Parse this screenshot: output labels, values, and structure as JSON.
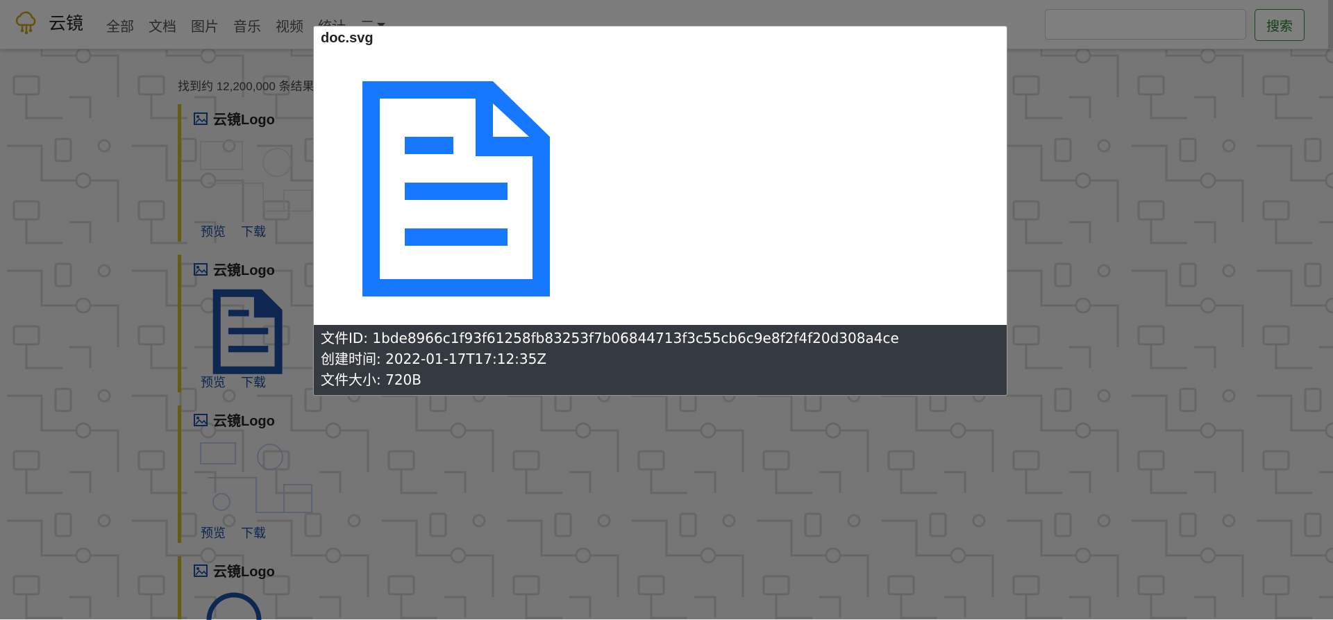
{
  "brand": {
    "name": "云镜"
  },
  "nav": {
    "links": [
      "全部",
      "文档",
      "图片",
      "音乐",
      "视频",
      "统计"
    ],
    "more_label": "三"
  },
  "search": {
    "placeholder": "",
    "button_label": "搜索"
  },
  "results": {
    "count_text": "找到约 12,200,000 条结果",
    "items": [
      {
        "title": "云镜Logo",
        "thumb": "pattern",
        "actions": [
          "预览",
          "下载"
        ]
      },
      {
        "title": "云镜Logo",
        "thumb": "document-icon",
        "actions": [
          "预览",
          "下载"
        ]
      },
      {
        "title": "云镜Logo",
        "thumb": "pattern-blue",
        "actions": [
          "预览",
          "下载"
        ]
      },
      {
        "title": "云镜Logo",
        "thumb": "circle",
        "actions": []
      }
    ]
  },
  "modal": {
    "title": "doc.svg",
    "image_icon": "document-icon",
    "info": {
      "file_id": "文件ID: 1bde8966c1f93f61258fb83253f7b06844713f3c55cb6c9e8f2f4f20d308a4ce",
      "created": "创建时间: 2022-01-17T17:12:35Z",
      "size": "文件大小: 720B"
    }
  },
  "colors": {
    "accent_blue": "#1677ff",
    "link_blue": "#1a4fa0",
    "result_border": "#c8b81c",
    "search_green": "#2e7d32",
    "info_bg": "#343a40"
  }
}
